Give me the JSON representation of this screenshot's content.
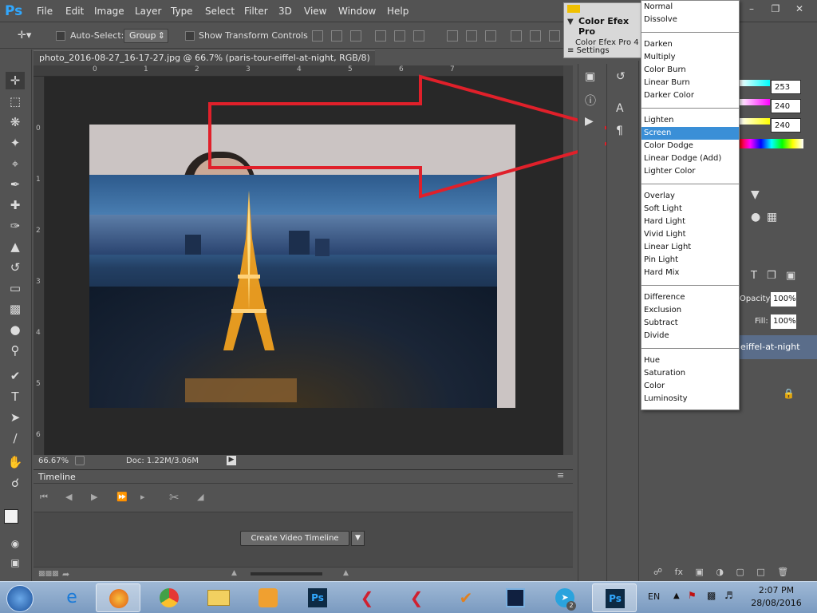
{
  "app": {
    "logo": "Ps"
  },
  "menu": [
    "File",
    "Edit",
    "Image",
    "Layer",
    "Type",
    "Select",
    "Filter",
    "3D",
    "View",
    "Window",
    "Help"
  ],
  "options": {
    "auto_select_label": "Auto-Select:",
    "group_value": "Group",
    "show_transform_label": "Show Transform Controls"
  },
  "document": {
    "tab_title": "photo_2016-08-27_16-17-27.jpg @ 66.7% (paris-tour-eiffel-at-night, RGB/8) *",
    "ruler_top": [
      "0",
      "1",
      "2",
      "3",
      "4",
      "5",
      "6",
      "7"
    ],
    "ruler_left": [
      "0",
      "1",
      "2",
      "3",
      "4",
      "5",
      "6"
    ],
    "zoom": "66.67%",
    "doc_size": "Doc: 1.22M/3.06M"
  },
  "timeline": {
    "title": "Timeline",
    "create_button": "Create Video Timeline"
  },
  "efex": {
    "title": "Color Efex Pro",
    "sub": "Color Efex Pro 4",
    "settings": "Settings"
  },
  "right_panel": {
    "values": [
      "253",
      "240",
      "240"
    ],
    "opacity_label": "Opacity:",
    "opacity": "100%",
    "fill_label": "Fill:",
    "fill": "100%",
    "layer_name": "eiffel-at-night"
  },
  "blend_modes": [
    [
      "Normal",
      "Dissolve"
    ],
    [
      "Darken",
      "Multiply",
      "Color Burn",
      "Linear Burn",
      "Darker Color"
    ],
    [
      "Lighten",
      "Screen",
      "Color Dodge",
      "Linear Dodge (Add)",
      "Lighter Color"
    ],
    [
      "Overlay",
      "Soft Light",
      "Hard Light",
      "Vivid Light",
      "Linear Light",
      "Pin Light",
      "Hard Mix"
    ],
    [
      "Difference",
      "Exclusion",
      "Subtract",
      "Divide"
    ],
    [
      "Hue",
      "Saturation",
      "Color",
      "Luminosity"
    ]
  ],
  "selected_blend": "Screen",
  "taskbar": {
    "lang": "EN",
    "time": "2:07 PM",
    "date": "28/08/2016",
    "badge": "2"
  },
  "colors": {
    "accent": "#3a8fd7",
    "arrow": "#e0202a"
  }
}
